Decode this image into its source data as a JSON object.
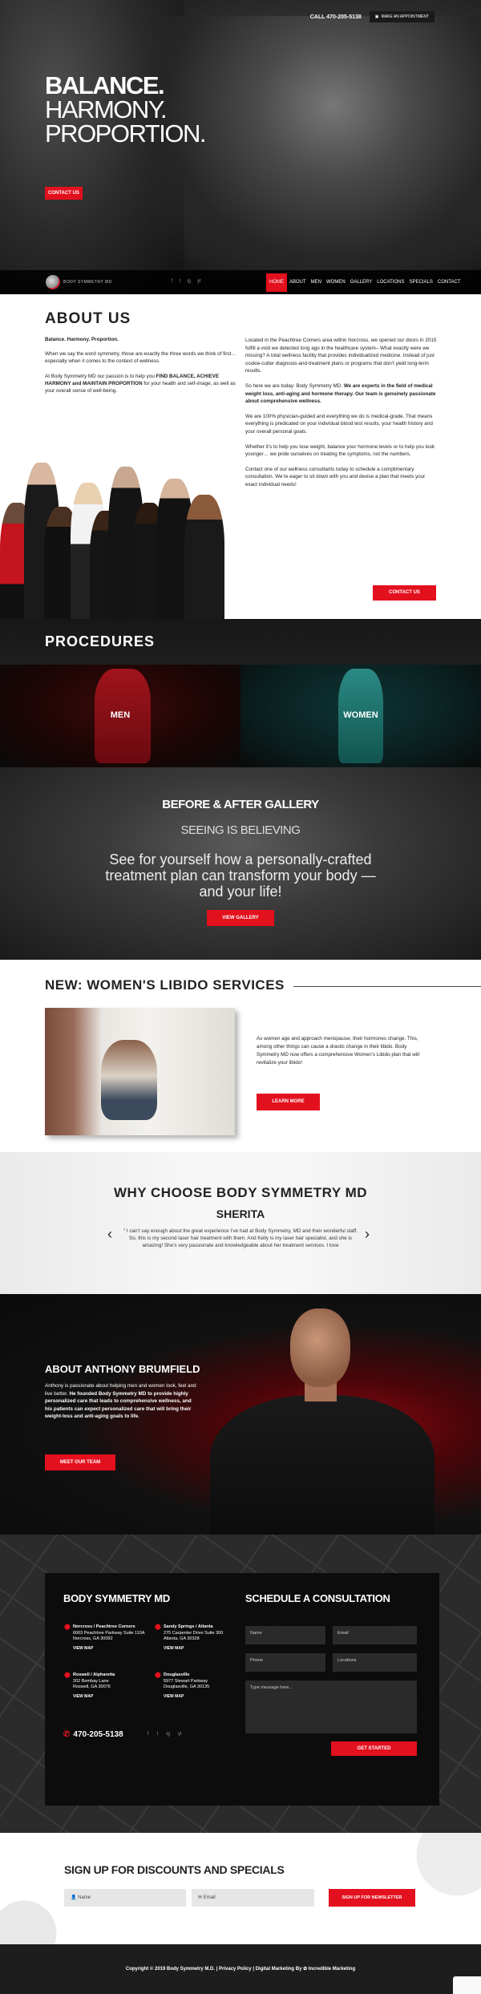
{
  "header": {
    "phone": "CALL 470-205-5138",
    "appointment": "MAKE AN APPOINTMENT",
    "headline": [
      "BALANCE.",
      "HARMONY.",
      "PROPORTION."
    ],
    "contact_btn": "CONTACT US"
  },
  "nav": {
    "logo_text": "BODY SYMMETRY MD",
    "social": [
      "f",
      "t",
      "ig",
      "yt"
    ],
    "items": [
      "HOME",
      "ABOUT",
      "MEN",
      "WOMEN",
      "GALLERY",
      "LOCATIONS",
      "SPECIALS",
      "CONTACT"
    ]
  },
  "about": {
    "title": "ABOUT US",
    "tagline": "Balance. Harmony. Proportion.",
    "p1": "When we say the word symmetry, those are exactly the three words we think of first… especially when it comes to the context of wellness.",
    "p2_a": "At Body Symmetry MD our passion is to help you ",
    "p2_b": "FIND BALANCE, ACHIEVE HARMONY and MAINTAIN PROPORTION",
    "p2_c": " for your health and self-image, as well as your overall sense of well-being.",
    "r1": "Located in the Peachtree Corners area within Norcross, we opened our doors in 2015 fulfill a void we detected long ago in the healthcare system– What exactly were we missing? A total wellness facility that provides individualized medicine. Instead of just cookie-cutter diagnosis-and-treatment plans or programs that don’t yield long-term results.",
    "r2_a": "So here we are today: Body Symmetry MD. ",
    "r2_b": "We are experts in the field of medical weight loss, anti-aging and hormone therapy. Our team is genuinely passionate about comprehensive wellness.",
    "r3": "We are 100% physician-guided and everything we do is medical-grade. That means everything is predicated on your individual blood test results, your health history and your overall personal goals.",
    "r4": "Whether it’s to help you lose weight, balance your hormone levels or to help you look younger… we pride ourselves on treating the symptoms, not the numbers.",
    "r5": "Contact one of our wellness consultants today to schedule a complimentary consultation. We’re eager to sit down with you and devise a plan that meets your exact individual needs!",
    "contact_btn": "CONTACT US"
  },
  "procedures": {
    "title": "PROCEDURES",
    "men": "MEN",
    "women": "WOMEN"
  },
  "gallery": {
    "title": "BEFORE & AFTER GALLERY",
    "subtitle": "SEEING IS BELIEVING",
    "text": "See for yourself how a personally-crafted treatment plan can transform your body — and your life!",
    "btn": "VIEW GALLERY"
  },
  "libido": {
    "title": "NEW: WOMEN'S LIBIDO SERVICES",
    "text": "As women age and approach menopause, their hormones change. This, among other things can cause a drastic change in their libido. Body Symmetry MD now offers a comprehensive Women’s Libido plan that will revitalize your libido!",
    "btn": "LEARN MORE"
  },
  "why": {
    "title": "WHY CHOOSE BODY SYMMETRY MD",
    "name": "SHERITA",
    "quote": "“ I can’t say enough about the great experience I’ve had at Body Symmetry, MD and their wonderful staff. So, this is my second laser hair treatment with them. And Kelly is my laser hair specialist, and she is amazing! She’s very passionate and knowledgeable about her treatment services. I love"
  },
  "anthony": {
    "title": "ABOUT ANTHONY BRUMFIELD",
    "text_a": "Anthony is passionate about helping men and women look, feel and live better. ",
    "text_b": "He founded Body Symmetry MD to provide highly personalized care that leads to comprehensive wellness, and his patients can expect personalized care that will bring their weight-loss and anti-aging goals to life.",
    "btn": "MEET OUR TEAM"
  },
  "footer": {
    "brand": "BODY SYMMETRY MD",
    "locations": [
      {
        "name": "Norcross / Peachtree Corners",
        "addr1": "6063 Peachtree Parkway Suite 110A",
        "addr2": "Norcross, GA 30092",
        "map": "VIEW MAP"
      },
      {
        "name": "Sandy Springs / Atlanta",
        "addr1": "275 Carpenter Drive Suite 300",
        "addr2": "Atlanta, GA 30328",
        "map": "VIEW MAP"
      },
      {
        "name": "Roswell / Alpharetta",
        "addr1": "202 Bombay Lane",
        "addr2": "Roswell, GA 30076",
        "map": "VIEW MAP"
      },
      {
        "name": "Douglasville",
        "addr1": "5977 Stewart Parkway",
        "addr2": "Douglasville, GA 30135",
        "map": "VIEW MAP"
      }
    ],
    "phone": "470-205-5138",
    "social": [
      "f",
      "t",
      "ig",
      "yt"
    ],
    "form_title": "SCHEDULE A CONSULTATION",
    "fields": {
      "name": "Name",
      "email": "Email",
      "phone": "Phone",
      "locations": "Locations",
      "message": "Type message here..."
    },
    "submit": "GET STARTED"
  },
  "signup": {
    "title": "SIGN UP FOR DISCOUNTS AND SPECIALS",
    "name_ph": "Name",
    "email_ph": "Email",
    "btn": "SIGN UP FOR NEWSLETTER"
  },
  "copyright": "Copyright © 2019 Body Symmetry M.D. | Privacy Policy | Digital Marketing By ✿ Incredible Marketing"
}
